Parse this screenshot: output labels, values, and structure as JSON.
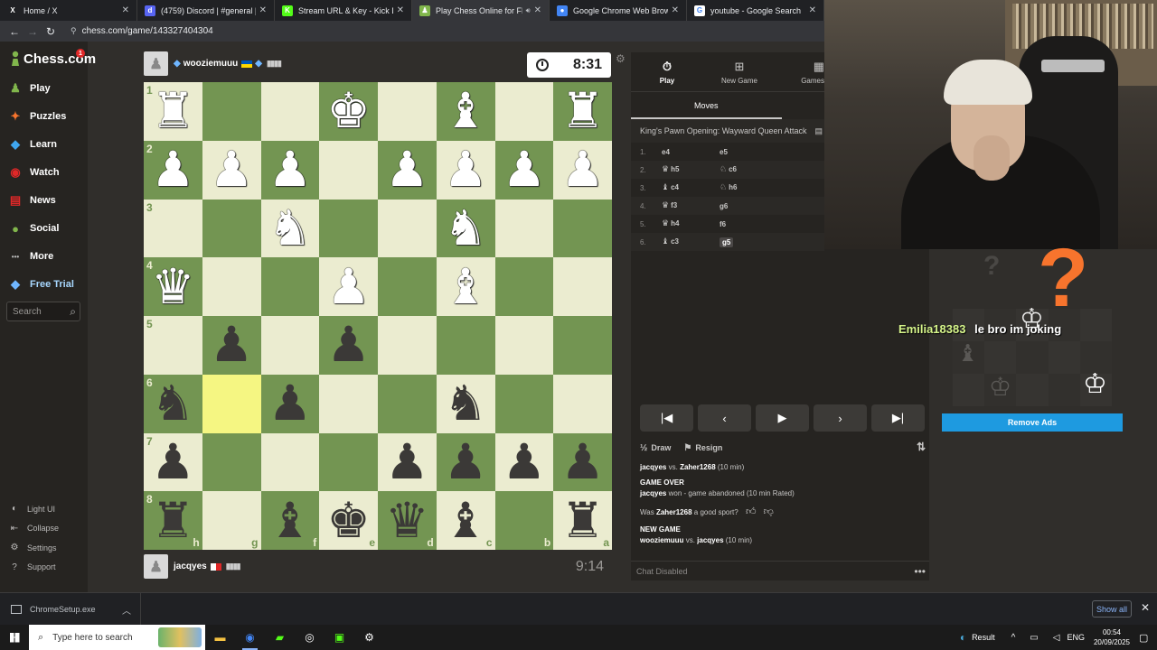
{
  "browser": {
    "tabs": [
      {
        "label": "Home / X",
        "icon": "x-logo-icon",
        "color": "#202124",
        "glyph": "X"
      },
      {
        "label": "(4759) Discord | #general | Galax",
        "icon": "discord-icon",
        "color": "#5865f2",
        "glyph": "d"
      },
      {
        "label": "Stream URL & Key - Kick Dashbo",
        "icon": "kick-icon",
        "color": "#53fc18",
        "glyph": "K"
      },
      {
        "label": "Play Chess Online for FREE -",
        "icon": "chess-icon",
        "color": "#81b64c",
        "glyph": "♟",
        "active": true
      },
      {
        "label": "Google Chrome Web Browser Fr",
        "icon": "chrome-icon",
        "color": "#4285f4",
        "glyph": "●"
      },
      {
        "label": "youtube - Google Search",
        "icon": "google-icon",
        "color": "#ffffff",
        "glyph": "G"
      }
    ],
    "url": "chess.com/game/143327404304"
  },
  "sidenav": {
    "logo_text": "Chess.com",
    "notification_count": "1",
    "items": [
      {
        "label": "Play",
        "icon": "play-icon"
      },
      {
        "label": "Puzzles",
        "icon": "puzzle-icon"
      },
      {
        "label": "Learn",
        "icon": "learn-icon"
      },
      {
        "label": "Watch",
        "icon": "watch-icon"
      },
      {
        "label": "News",
        "icon": "news-icon"
      },
      {
        "label": "Social",
        "icon": "social-icon"
      },
      {
        "label": "More",
        "icon": "more-icon"
      },
      {
        "label": "Free Trial",
        "icon": "diamond-icon"
      }
    ],
    "search_placeholder": "Search",
    "bottom": [
      {
        "label": "Light UI",
        "icon": "light-ui-icon"
      },
      {
        "label": "Collapse",
        "icon": "collapse-icon"
      },
      {
        "label": "Settings",
        "icon": "settings-icon"
      },
      {
        "label": "Support",
        "icon": "support-icon"
      }
    ]
  },
  "game": {
    "top_player": {
      "name": "wooziemuuu",
      "clock": "8:31"
    },
    "bottom_player": {
      "name": "jacqyes",
      "clock": "9:14"
    },
    "ranks": [
      "1",
      "2",
      "3",
      "4",
      "5",
      "6",
      "7",
      "8"
    ],
    "files": [
      "h",
      "g",
      "f",
      "e",
      "d",
      "c",
      "b",
      "a"
    ],
    "board": [
      [
        "wR",
        "",
        "",
        "wK",
        "",
        "wB",
        "",
        "wR"
      ],
      [
        "wP",
        "wP",
        "wP",
        "",
        "wP",
        "wP",
        "wP",
        "wP"
      ],
      [
        "",
        "",
        "wN",
        "",
        "",
        "wN",
        "",
        ""
      ],
      [
        "wQ",
        "",
        "",
        "wP",
        "",
        "wB",
        "",
        ""
      ],
      [
        "",
        "bP",
        "",
        "bP",
        "",
        "",
        "",
        ""
      ],
      [
        "bN",
        "",
        "bP",
        "",
        "",
        "bN",
        "",
        ""
      ],
      [
        "bP",
        "",
        "",
        "",
        "bP",
        "bP",
        "bP",
        "bP"
      ],
      [
        "bR",
        "",
        "bB",
        "bK",
        "bQ",
        "bB",
        "",
        "bR"
      ]
    ],
    "highlight": [
      5,
      1
    ]
  },
  "panel": {
    "tabs": [
      {
        "label": "Play",
        "icon": "stopwatch-icon"
      },
      {
        "label": "New Game",
        "icon": "plus-icon"
      },
      {
        "label": "Games",
        "icon": "games-icon"
      }
    ],
    "moves_tab": "Moves",
    "opening": "King's Pawn Opening: Wayward Queen Attack",
    "moves": [
      {
        "num": "1.",
        "w": "e4",
        "wfig": "",
        "b": "e5",
        "bfig": ""
      },
      {
        "num": "2.",
        "w": "h5",
        "wfig": "♛",
        "b": "c6",
        "bfig": "♘"
      },
      {
        "num": "3.",
        "w": "c4",
        "wfig": "♝",
        "b": "h6",
        "bfig": "♘"
      },
      {
        "num": "4.",
        "w": "f3",
        "wfig": "♛",
        "b": "g6",
        "bfig": ""
      },
      {
        "num": "5.",
        "w": "h4",
        "wfig": "♛",
        "b": "f6",
        "bfig": ""
      },
      {
        "num": "6.",
        "w": "c3",
        "wfig": "♝",
        "b": "g5",
        "bfig": "",
        "current": true
      }
    ],
    "actions": {
      "draw": "Draw",
      "resign": "Resign"
    },
    "chat": {
      "line1_a": "jacqyes",
      "line1_b": "vs.",
      "line1_c": "Zaher1268",
      "line1_d": "(10 min)",
      "game_over": "GAME OVER",
      "line2_a": "jacqyes",
      "line2_b": "won - game abandoned (10 min Rated)",
      "sport_a": "Was",
      "sport_b": "Zaher1268",
      "sport_c": "a good sport?",
      "new_game": "NEW GAME",
      "line3_a": "wooziemuuu",
      "line3_b": "vs.",
      "line3_c": "jacqyes",
      "line3_d": "(10 min)",
      "disabled": "Chat Disabled"
    }
  },
  "overlay": {
    "chat_user": "Emilia18383",
    "chat_message": "le bro im joking",
    "remove_ads": "Remove Ads"
  },
  "download": {
    "file": "ChromeSetup.exe",
    "show_all": "Show all"
  },
  "taskbar": {
    "search_placeholder": "Type here to search",
    "result": "Result",
    "lang": "ENG",
    "time": "00:54",
    "date": "20/09/2025"
  }
}
